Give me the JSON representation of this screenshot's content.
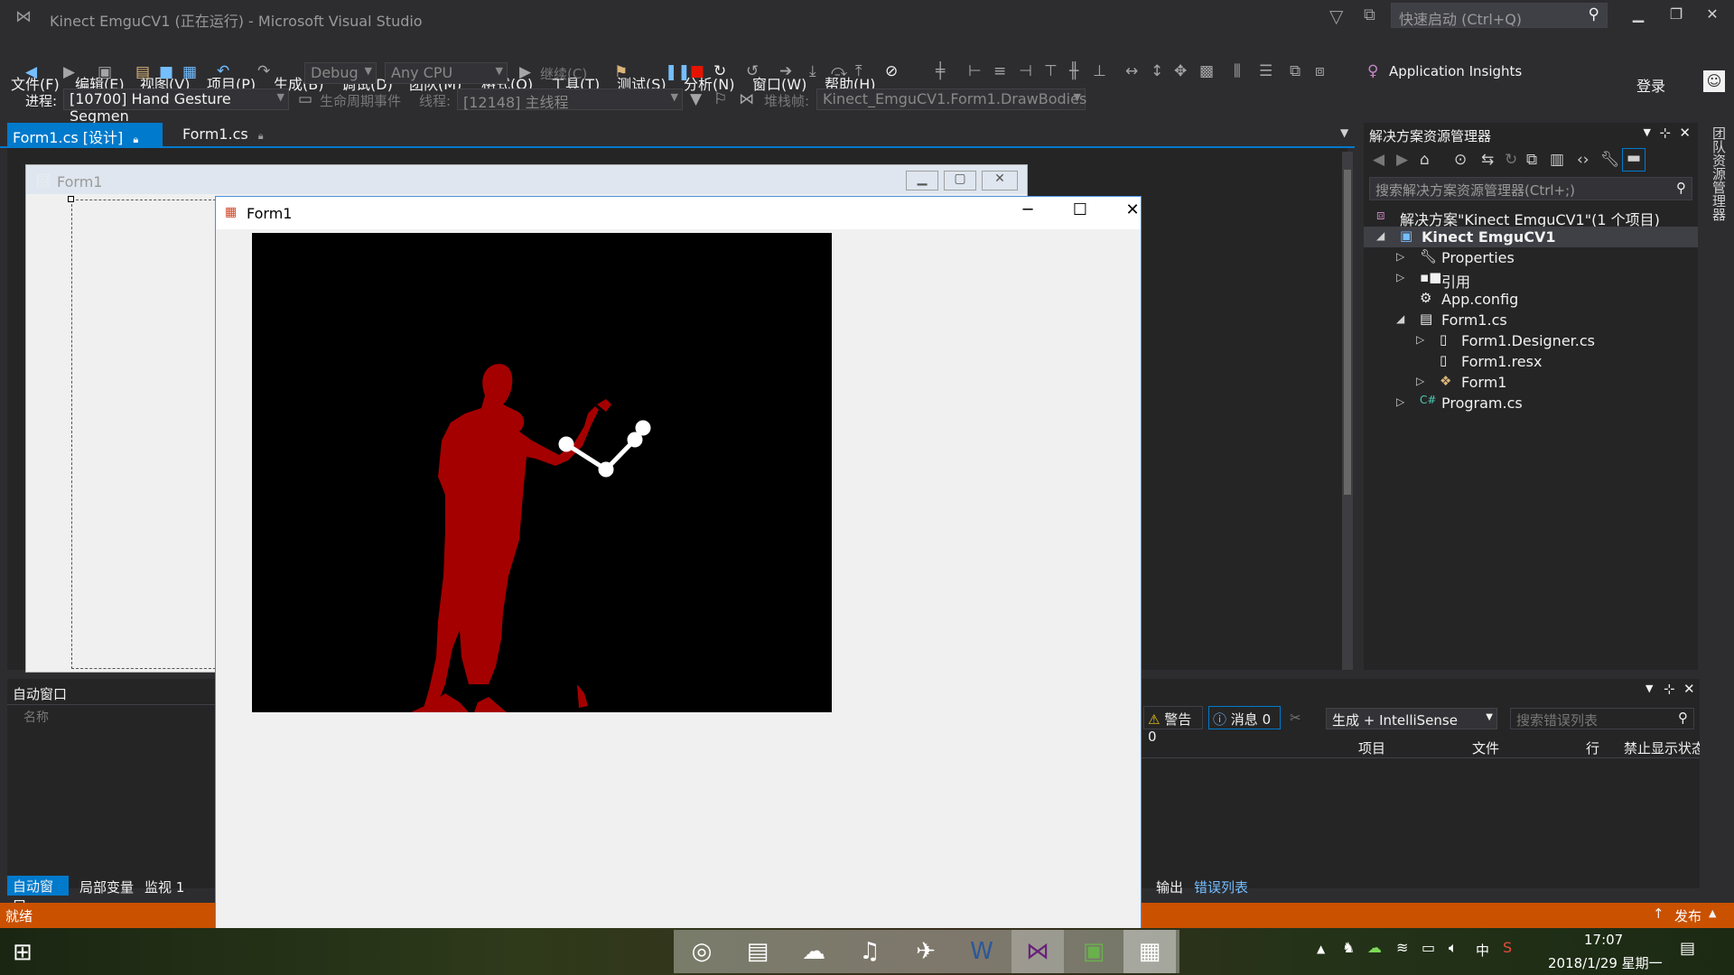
{
  "window": {
    "title": "Kinect EmguCV1 (正在运行) - Microsoft Visual Studio",
    "quick_launch_placeholder": "快速启动 (Ctrl+Q)"
  },
  "menu": [
    "文件(F)",
    "编辑(E)",
    "视图(V)",
    "项目(P)",
    "生成(B)",
    "调试(D)",
    "团队(M)",
    "格式(O)",
    "工具(T)",
    "测试(S)",
    "分析(N)",
    "窗口(W)",
    "帮助(H)"
  ],
  "account": {
    "login_label": "登录"
  },
  "toolbar": {
    "config": "Debug",
    "platform": "Any CPU",
    "continue_label": "继续(C)",
    "app_insights": "Application Insights",
    "process_label": "进程:",
    "process_value": "[10700] Hand Gesture Segmen",
    "lifecycle_label": "生命周期事件",
    "thread_label": "线程:",
    "thread_value": "[12148] 主线程",
    "stackframe_label": "堆栈帧:",
    "stackframe_value": "Kinect_EmguCV1.Form1.DrawBodies"
  },
  "tabs": [
    {
      "label": "Form1.cs [设计]",
      "active": true
    },
    {
      "label": "Form1.cs",
      "active": false
    }
  ],
  "designer": {
    "form_title": "Form1"
  },
  "running_form": {
    "title": "Form1"
  },
  "solution_explorer": {
    "title": "解决方案资源管理器",
    "search_placeholder": "搜索解决方案资源管理器(Ctrl+;)",
    "items": [
      {
        "label": "解决方案\"Kinect EmguCV1\"(1 个项目)",
        "icon": "solution-icon"
      },
      {
        "label": "Kinect EmguCV1",
        "icon": "csharp-project-icon",
        "selected": true
      },
      {
        "label": "Properties",
        "icon": "wrench-icon"
      },
      {
        "label": "引用",
        "icon": "references-icon"
      },
      {
        "label": "App.config",
        "icon": "config-file-icon"
      },
      {
        "label": "Form1.cs",
        "icon": "form-icon"
      },
      {
        "label": "Form1.Designer.cs",
        "icon": "file-icon"
      },
      {
        "label": "Form1.resx",
        "icon": "file-icon"
      },
      {
        "label": "Form1",
        "icon": "class-icon"
      },
      {
        "label": "Program.cs",
        "icon": "csharp-file-icon"
      }
    ]
  },
  "side_tab": "团队资源管理器",
  "auto_window": {
    "title": "自动窗口",
    "column_name": "名称",
    "tabs": [
      "自动窗口",
      "局部变量",
      "监视 1"
    ]
  },
  "error_list": {
    "warnings": "警告 0",
    "messages": "消息 0",
    "build_filter": "生成 + IntelliSense",
    "search_placeholder": "搜索错误列表",
    "columns": [
      "项目",
      "文件",
      "行",
      "禁止显示状态"
    ],
    "tabs": [
      "输出",
      "错误列表"
    ]
  },
  "status": {
    "text": "就绪",
    "publish": "发布"
  },
  "taskbar": {
    "time": "17:07",
    "date": "2018/1/29 星期一",
    "ime": "中"
  },
  "colors": {
    "accent": "#007acc",
    "status_bar": "#ca5100",
    "silhouette": "#a50000"
  }
}
